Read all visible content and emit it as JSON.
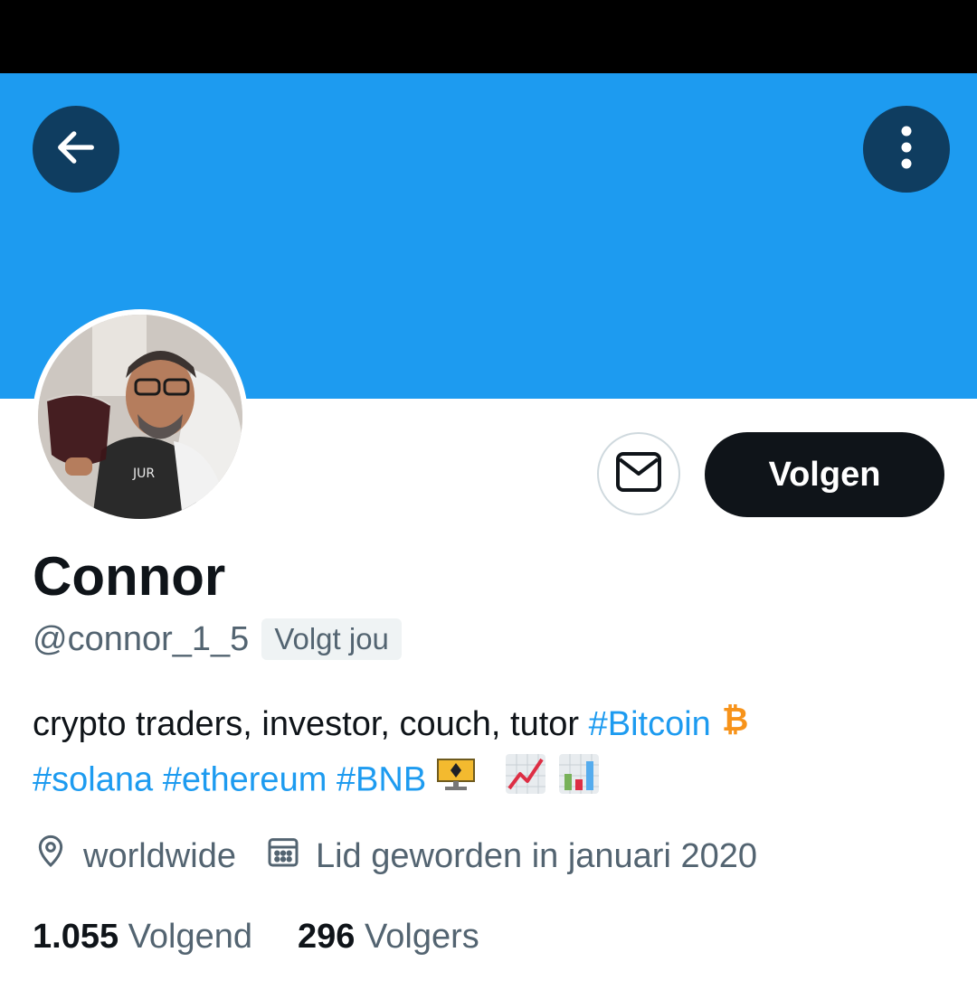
{
  "header": {
    "back_icon": "arrow-left-icon",
    "more_icon": "more-vertical-icon"
  },
  "profile": {
    "name": "Connor",
    "handle": "@connor_1_5",
    "follows_you_label": "Volgt jou",
    "dm_icon": "envelope-icon",
    "follow_label": "Volgen",
    "bio": {
      "text": "crypto traders, investor, couch, tutor ",
      "hashtags": [
        "#Bitcoin",
        "#solana",
        "#ethereum",
        "#BNB"
      ]
    },
    "location": "worldwide",
    "joined": "Lid geworden in januari 2020",
    "following_count": "1.055",
    "following_label": "Volgend",
    "followers_count": "296",
    "followers_label": "Volgers"
  },
  "colors": {
    "banner": "#1d9bf0",
    "accent": "#1d9bf0",
    "text": "#0f1419",
    "secondary_text": "#536471",
    "bitcoin": "#f7931a"
  }
}
